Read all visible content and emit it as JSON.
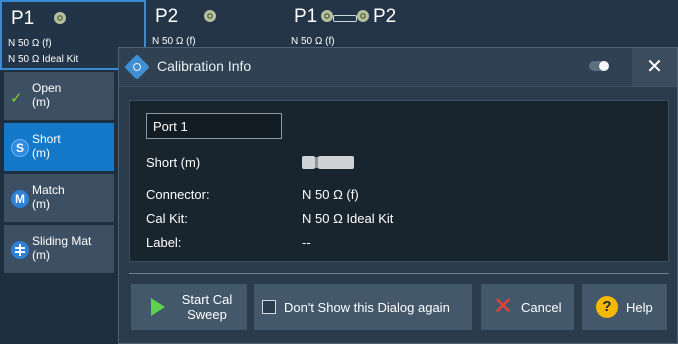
{
  "ports": {
    "p1": {
      "name": "P1",
      "connector": "N 50 Ω (f)",
      "cal_kit": "N 50 Ω Ideal Kit"
    },
    "p2": {
      "name": "P2",
      "connector": "N 50 Ω (f)"
    },
    "thru": {
      "from": "P1",
      "to": "P2",
      "connector": "N 50 Ω (f)"
    }
  },
  "standards": [
    {
      "label_line1": "Open",
      "label_line2": "(m)",
      "status": "done",
      "badge": ""
    },
    {
      "label_line1": "Short",
      "label_line2": "(m)",
      "status": "active",
      "badge": "S"
    },
    {
      "label_line1": "Match",
      "label_line2": "(m)",
      "status": "pending",
      "badge": "M"
    },
    {
      "label_line1": "Sliding Mat",
      "label_line2": "(m)",
      "status": "pending",
      "badge": ""
    }
  ],
  "dialog": {
    "title": "Calibration Info",
    "close_label": "✕",
    "port_field_value": "Port 1",
    "standard_name": "Short (m)",
    "fields": {
      "connector_key": "Connector:",
      "connector_value": "N 50 Ω (f)",
      "calkit_key": "Cal Kit:",
      "calkit_value": "N 50 Ω Ideal Kit",
      "label_key": "Label:",
      "label_value": "--"
    },
    "buttons": {
      "start_line1": "Start Cal",
      "start_line2": "Sweep",
      "dont_show": "Don't Show this Dialog again",
      "dont_show_checked": false,
      "cancel": "Cancel",
      "help": "Help"
    }
  },
  "colors": {
    "background": "#1e2f40",
    "accent": "#1378c8",
    "play": "#5fd34b",
    "cancel": "#e8413c",
    "help": "#f5b800"
  }
}
